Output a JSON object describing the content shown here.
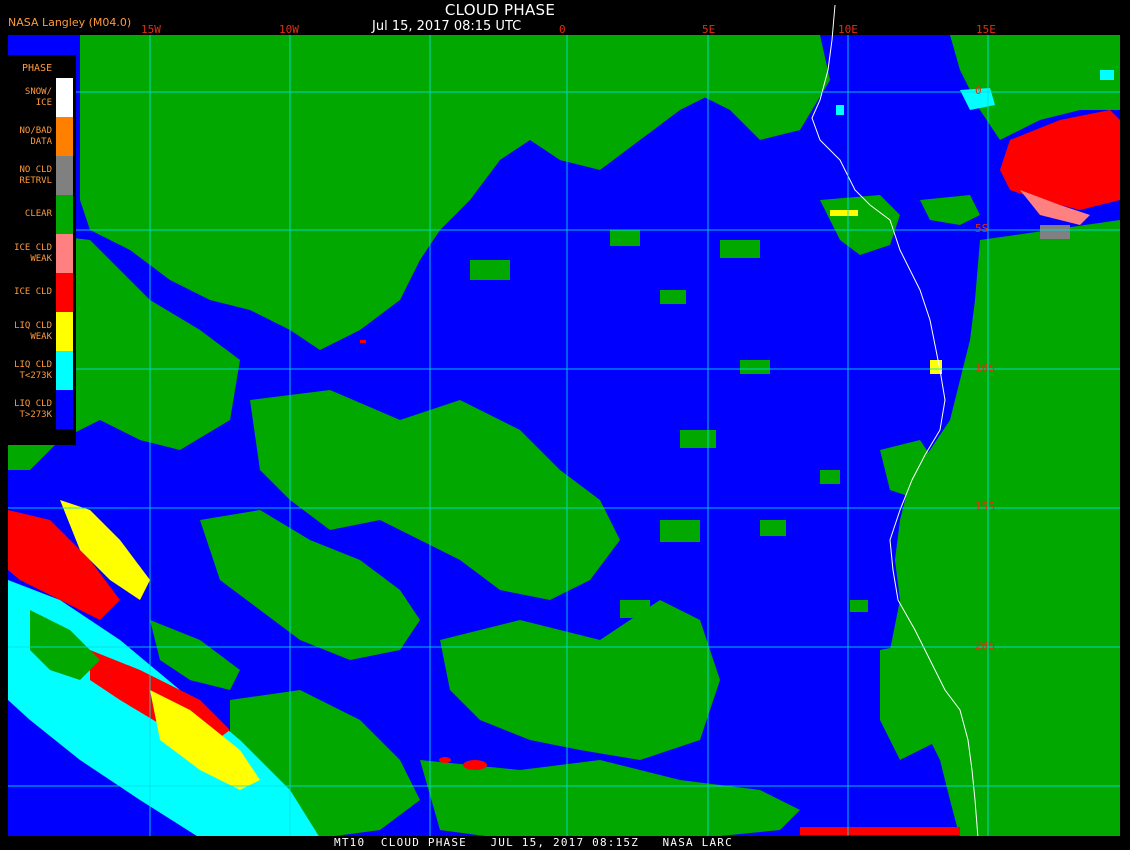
{
  "header": {
    "producer": "NASA Langley (M04.0)",
    "title": "CLOUD PHASE",
    "datetime": "Jul 15, 2017 08:15 UTC"
  },
  "footer": {
    "caption": "MT10  CLOUD PHASE   JUL 15, 2017 08:15Z   NASA LARC"
  },
  "grid": {
    "longitudes": [
      "15W",
      "10W",
      "0",
      "5E",
      "10E",
      "15E"
    ],
    "latitudes": [
      "0",
      "5S",
      "10S",
      "15S",
      "20S"
    ]
  },
  "legend": {
    "title": "PHASE",
    "entries": [
      {
        "label": "SNOW/\nICE",
        "color": "#ffffff"
      },
      {
        "label": "NO/BAD\nDATA",
        "color": "#ff8000"
      },
      {
        "label": "NO CLD\nRETRVL",
        "color": "#808080"
      },
      {
        "label": "CLEAR",
        "color": "#00a800"
      },
      {
        "label": "ICE CLD\nWEAK",
        "color": "#ff8080"
      },
      {
        "label": "ICE CLD",
        "color": "#ff0000"
      },
      {
        "label": "LIQ CLD\nWEAK",
        "color": "#ffff00"
      },
      {
        "label": "LIQ CLD\nT<273K",
        "color": "#00ffff"
      },
      {
        "label": "LIQ CLD\nT>273K",
        "color": "#0000ff"
      }
    ]
  },
  "colors": {
    "clear": "#00a800",
    "liquid_warm": "#0000ff",
    "liquid_cold": "#00ffff",
    "liquid_weak": "#ffff00",
    "ice": "#ff0000",
    "ice_weak": "#ff8080",
    "no_retrieval": "#808080",
    "gridline": "#00e0e0",
    "coastline": "#ffffff",
    "label_orange": "#ff9a3c",
    "grid_label": "#e03010"
  }
}
